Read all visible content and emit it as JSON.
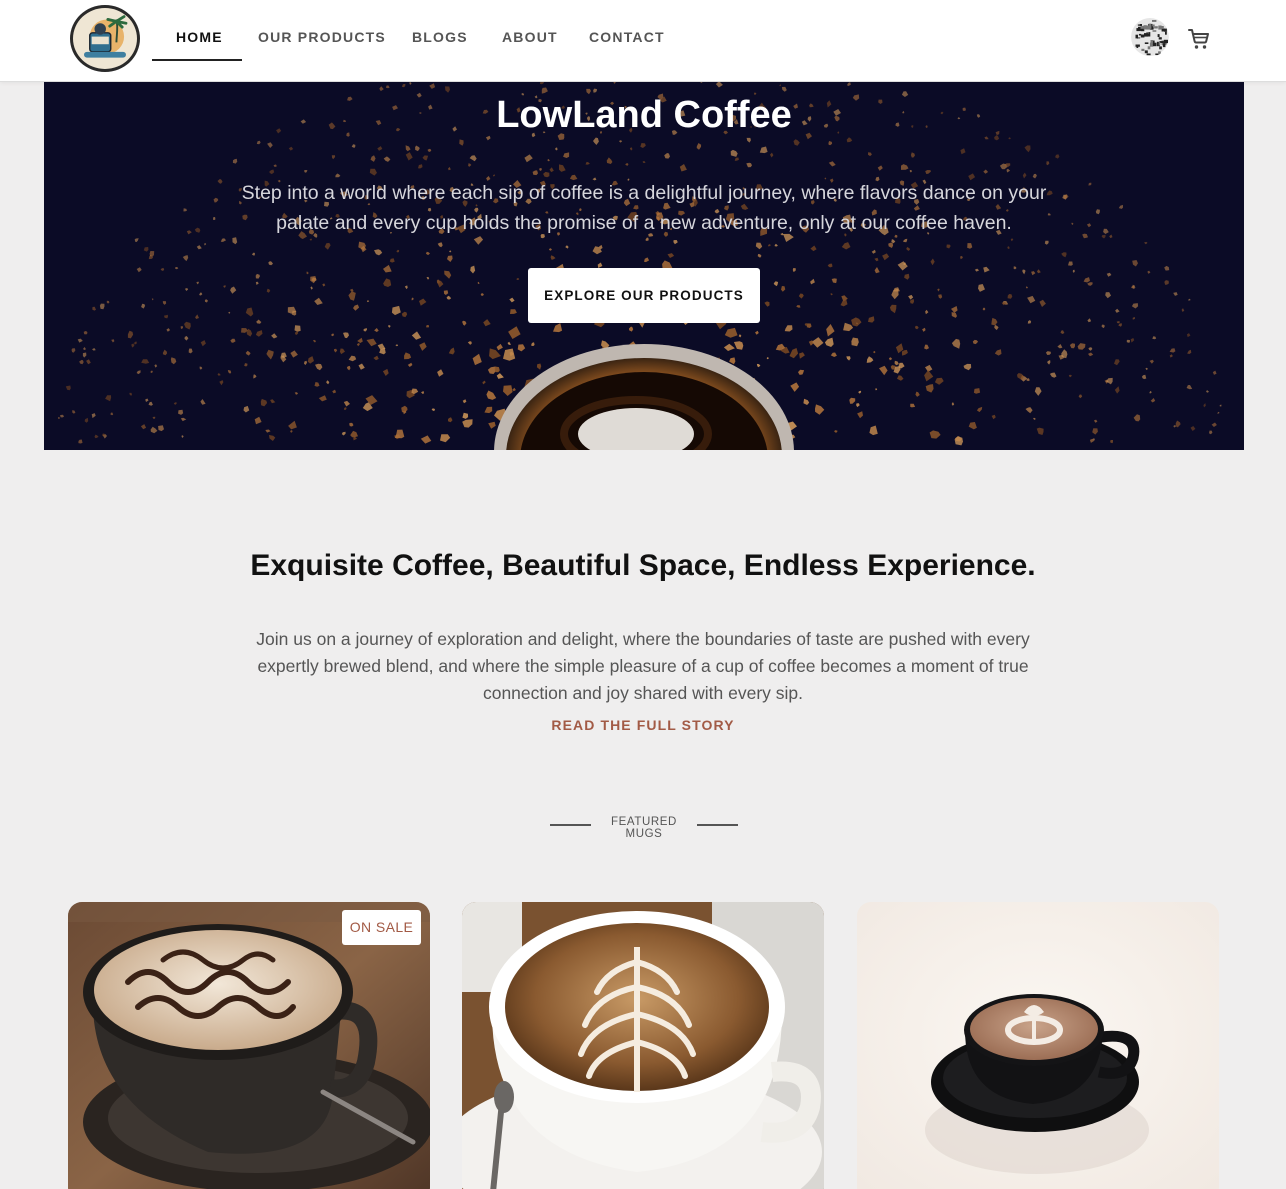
{
  "nav": {
    "items": [
      {
        "label": "HOME",
        "active": true
      },
      {
        "label": "OUR PRODUCTS",
        "active": false
      },
      {
        "label": "BLOGS",
        "active": false
      },
      {
        "label": "ABOUT",
        "active": false
      },
      {
        "label": "CONTACT",
        "active": false
      }
    ],
    "cart_icon": "shopping-cart-icon",
    "avatar_icon": "user-avatar"
  },
  "hero": {
    "title": "LowLand Coffee",
    "text": "Step into a world where each sip of coffee is a delightful journey, where flavors dance on your palate and every cup holds the promise of a new adventure, only at our coffee haven.",
    "button_label": "EXPLORE OUR PRODUCTS"
  },
  "about": {
    "heading": "Exquisite Coffee, Beautiful Space, Endless Experience.",
    "text": "Join us on a journey of exploration and delight, where the boundaries of taste are pushed with every expertly brewed blend, and where the simple pleasure of a cup of coffee becomes a moment of true connection and joy shared with every sip.",
    "link_label": "READ THE FULL STORY"
  },
  "featured": {
    "label": "FEATURED MUGS",
    "cards": [
      {
        "badge": "ON SALE"
      },
      {
        "badge": ""
      },
      {
        "badge": ""
      }
    ]
  },
  "colors": {
    "hero_bg": "#0b0b26",
    "accent": "#a25a45",
    "page_bg": "#efeeee"
  }
}
